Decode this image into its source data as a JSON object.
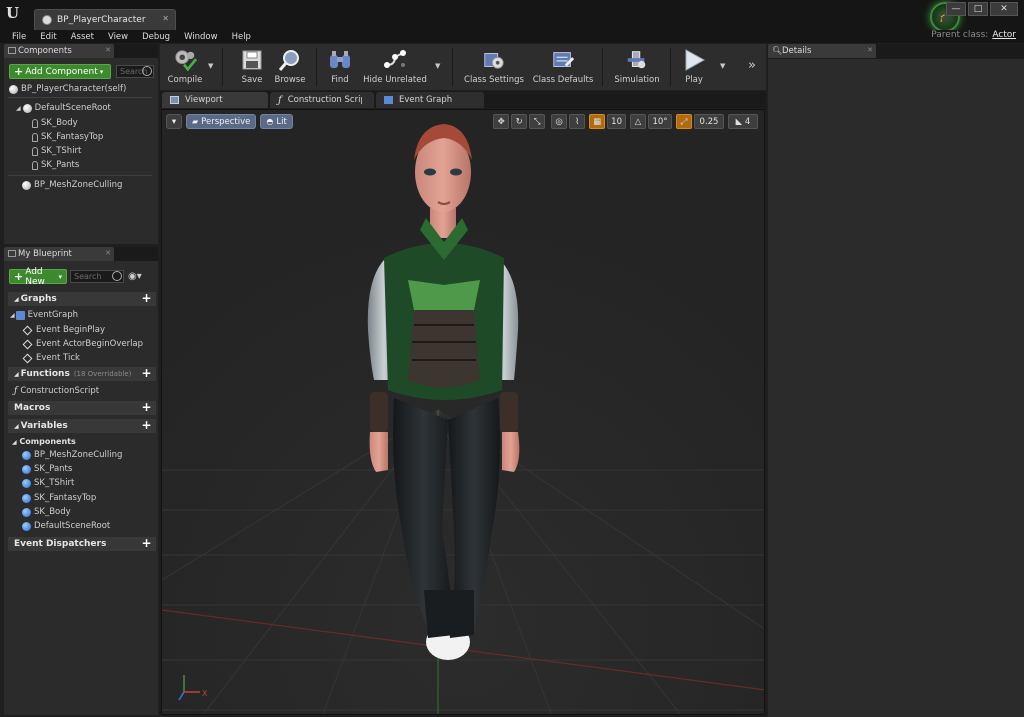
{
  "window": {
    "tab_title": "BP_PlayerCharacter",
    "logo": "U",
    "minimize": "—",
    "maximize": "□",
    "close": "✕",
    "parent_class_label": "Parent class:",
    "parent_class_value": "Actor"
  },
  "menu": [
    "File",
    "Edit",
    "Asset",
    "View",
    "Debug",
    "Window",
    "Help"
  ],
  "components_panel": {
    "tab": "Components",
    "add_button": "Add Component",
    "search_placeholder": "Search",
    "self_item": "BP_PlayerCharacter(self)",
    "root": "DefaultSceneRoot",
    "children": [
      "SK_Body",
      "SK_FantasyTop",
      "SK_TShirt",
      "SK_Pants"
    ],
    "extra": "BP_MeshZoneCulling"
  },
  "my_blueprint": {
    "tab": "My Blueprint",
    "add_button": "Add New",
    "search_placeholder": "Search",
    "graphs_header": "Graphs",
    "event_graph": "EventGraph",
    "events": [
      "Event BeginPlay",
      "Event ActorBeginOverlap",
      "Event Tick"
    ],
    "functions_header": "Functions",
    "functions_sub": "(18 Overridable)",
    "construction_script": "ConstructionScript",
    "macros_header": "Macros",
    "variables_header": "Variables",
    "components_sub": "Components",
    "variables": [
      "BP_MeshZoneCulling",
      "SK_Pants",
      "SK_TShirt",
      "SK_FantasyTop",
      "SK_Body",
      "DefaultSceneRoot"
    ],
    "dispatchers_header": "Event Dispatchers"
  },
  "toolbar": {
    "compile": "Compile",
    "save": "Save",
    "browse": "Browse",
    "find": "Find",
    "hide_unrelated": "Hide Unrelated",
    "class_settings": "Class Settings",
    "class_defaults": "Class Defaults",
    "simulation": "Simulation",
    "play": "Play"
  },
  "editor_tabs": [
    "Viewport",
    "Construction Script",
    "Event Graph"
  ],
  "viewport": {
    "perspective": "Perspective",
    "lit": "Lit",
    "grid_snap": "10",
    "rot_snap": "10°",
    "scale_snap": "0.25",
    "cam_speed": "4"
  },
  "details_panel": {
    "tab": "Details"
  },
  "colors": {
    "accent_green": "#3d8a2e",
    "viewport_bg": "#282828",
    "panel_bg": "#2b2b2b"
  }
}
